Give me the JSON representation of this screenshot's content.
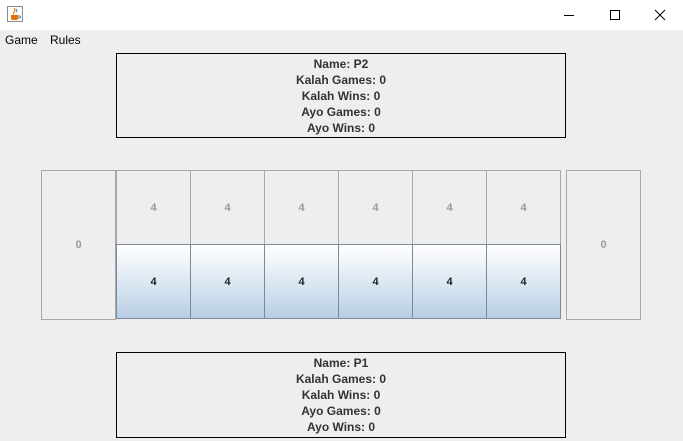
{
  "window": {
    "icon": "java-cup-icon"
  },
  "menu": {
    "items": [
      {
        "label": "Game"
      },
      {
        "label": "Rules"
      }
    ]
  },
  "player_top": {
    "lines": [
      "Name: P2",
      "Kalah Games: 0",
      "Kalah Wins: 0",
      "Ayo Games: 0",
      "Ayo Wins: 0"
    ]
  },
  "player_bottom": {
    "lines": [
      "Name: P1",
      "Kalah Games: 0",
      "Kalah Wins: 0",
      "Ayo Games: 0",
      "Ayo Wins: 0"
    ]
  },
  "board": {
    "store_left": "0",
    "store_right": "0",
    "top_pits": [
      "4",
      "4",
      "4",
      "4",
      "4",
      "4"
    ],
    "bottom_pits": [
      "4",
      "4",
      "4",
      "4",
      "4",
      "4"
    ]
  },
  "colors": {
    "active_pit_gradient_top": "#ffffff",
    "active_pit_gradient_bottom": "#b8cee4",
    "inactive_text": "#9a9a9a"
  }
}
